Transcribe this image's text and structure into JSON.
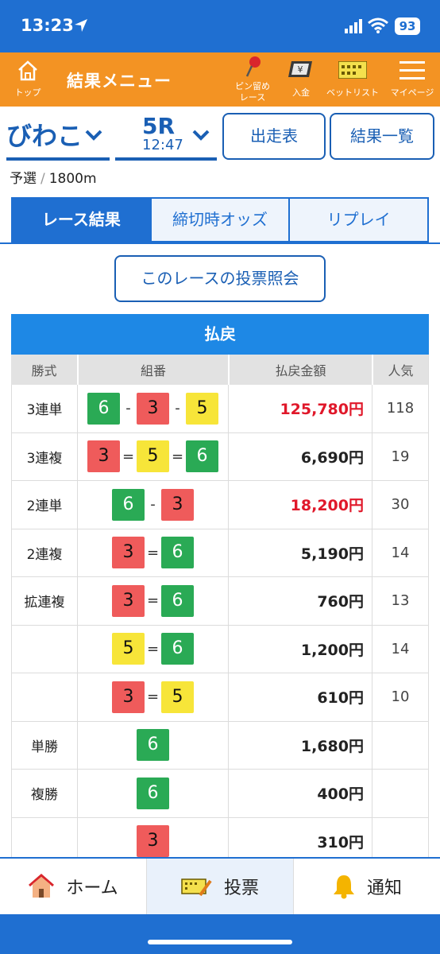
{
  "status_bar": {
    "time": "13:23",
    "battery": "93"
  },
  "header": {
    "home_label": "トップ",
    "title": "結果メニュー",
    "pin_label_1": "ピン留め",
    "pin_label_2": "レース",
    "deposit_label": "入金",
    "betlist_label": "ベットリスト",
    "mypage_label": "マイページ"
  },
  "selector": {
    "venue": "びわこ",
    "race_number": "5R",
    "race_time": "12:47",
    "entry_table_button": "出走表",
    "results_list_button": "結果一覧"
  },
  "race_info": {
    "category": "予選",
    "distance": "1800m"
  },
  "tabs": [
    {
      "label": "レース結果",
      "active": true
    },
    {
      "label": "締切時オッズ",
      "active": false
    },
    {
      "label": "リプレイ",
      "active": false
    }
  ],
  "vote_inquiry_button": "このレースの投票照会",
  "payout": {
    "title": "払戻",
    "headers": {
      "bet_type": "勝式",
      "combination": "組番",
      "amount": "払戻金額",
      "popularity": "人気"
    },
    "rows": [
      {
        "bet_type": "3連単",
        "boats": [
          "6",
          "3",
          "5"
        ],
        "sep": "-",
        "amount": "125,780円",
        "popularity": "118",
        "highlight": true
      },
      {
        "bet_type": "3連複",
        "boats": [
          "3",
          "5",
          "6"
        ],
        "sep": "=",
        "amount": "6,690円",
        "popularity": "19",
        "highlight": false
      },
      {
        "bet_type": "2連単",
        "boats": [
          "6",
          "3"
        ],
        "sep": "-",
        "amount": "18,200円",
        "popularity": "30",
        "highlight": true
      },
      {
        "bet_type": "2連複",
        "boats": [
          "3",
          "6"
        ],
        "sep": "=",
        "amount": "5,190円",
        "popularity": "14",
        "highlight": false
      },
      {
        "bet_type": "拡連複",
        "boats": [
          "3",
          "6"
        ],
        "sep": "=",
        "amount": "760円",
        "popularity": "13",
        "highlight": false
      },
      {
        "bet_type": "",
        "boats": [
          "5",
          "6"
        ],
        "sep": "=",
        "amount": "1,200円",
        "popularity": "14",
        "highlight": false
      },
      {
        "bet_type": "",
        "boats": [
          "3",
          "5"
        ],
        "sep": "=",
        "amount": "610円",
        "popularity": "10",
        "highlight": false
      },
      {
        "bet_type": "単勝",
        "boats": [
          "6"
        ],
        "sep": "",
        "amount": "1,680円",
        "popularity": "",
        "highlight": false
      },
      {
        "bet_type": "複勝",
        "boats": [
          "6"
        ],
        "sep": "",
        "amount": "400円",
        "popularity": "",
        "highlight": false
      },
      {
        "bet_type": "",
        "boats": [
          "3"
        ],
        "sep": "",
        "amount": "310円",
        "popularity": "",
        "highlight": false
      }
    ]
  },
  "boat_colors": {
    "3": "#ef5b5b",
    "5": "#f7e539",
    "6": "#2aaa55"
  },
  "accent_colors": {
    "header": "#f39323",
    "primary": "#1f6fd1",
    "payout_red": "#e0182a"
  },
  "bottom_nav": {
    "home": "ホーム",
    "vote": "投票",
    "notify": "通知"
  }
}
